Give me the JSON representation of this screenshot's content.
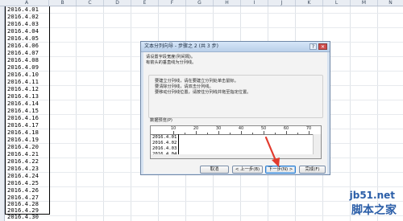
{
  "sheet": {
    "column_headers": [
      "A",
      "B",
      "C",
      "D",
      "E",
      "F",
      "G",
      "H",
      "I",
      "J",
      "K",
      "L",
      "M",
      "N"
    ],
    "cells": [
      "2016.4.01",
      "2016.4.02",
      "2016.4.03",
      "2016.4.04",
      "2016.4.05",
      "2016.4.06",
      "2016.4.07",
      "2016.4.08",
      "2016.4.09",
      "2016.4.10",
      "2016.4.11",
      "2016.4.12",
      "2016.4.13",
      "2016.4.14",
      "2016.4.15",
      "2016.4.16",
      "2016.4.17",
      "2016.4.18",
      "2016.4.19",
      "2016.4.20",
      "2016.4.21",
      "2016.4.22",
      "2016.4.23",
      "2016.4.24",
      "2016.4.25",
      "2016.4.26",
      "2016.4.27",
      "2016.4.28",
      "2016.4.29",
      "2016.4.30"
    ]
  },
  "dialog": {
    "title": "文本分列向导 - 步骤之 2 (共 3 步)",
    "help_label": "?",
    "close_label": "✕",
    "intro_line1": "请设置字段宽度(列间隔)。",
    "intro_line2": "有箭头的垂直线为分列线。",
    "instr1": "要建立分列线，请在要建立分列处单击鼠标。",
    "instr2": "要清除分列线，请双击分列线。",
    "instr3": "要移动分列线位置，请按住分列线并拖至指定位置。",
    "preview_label": "数据预览(P)",
    "ruler_numbers": [
      "10",
      "20",
      "30",
      "40",
      "50",
      "60",
      "70"
    ],
    "preview_rows": [
      "2016.4.01",
      "2016.4.02",
      "2016.4.03",
      "2016.4.04"
    ],
    "buttons": {
      "cancel": "取消",
      "back": "< 上一步(B)",
      "next": "下一步(N) >",
      "finish": "完成(F)"
    }
  },
  "watermark": {
    "line1": "jb51.net",
    "line2": "脚本之家"
  },
  "colors": {
    "accent": "#2f7fd0",
    "arrow": "#e23b2e",
    "watermark": "#2b5ea8"
  }
}
